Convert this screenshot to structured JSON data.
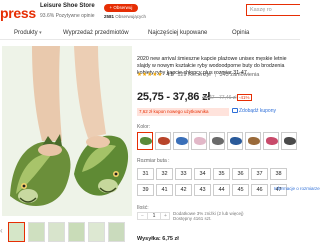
{
  "header": {
    "logo": "press",
    "store_name": "Leisure Shoe Store",
    "store_rating": "93.6% Pozytywne opinie",
    "follow_label": "+ Obserwuj",
    "followers_count": "2581",
    "followers_label": "Obserwujących",
    "search_placeholder": "Kaszę ro"
  },
  "nav": {
    "items": [
      {
        "label": "Produkty",
        "dropdown": true
      },
      {
        "label": "Wyprzedaż przedmiotów",
        "dropdown": false
      },
      {
        "label": "Najczęściej kupowane",
        "dropdown": false
      },
      {
        "label": "Opinia",
        "dropdown": false
      }
    ]
  },
  "product": {
    "title": "2020 new arrival śmieszne kapcie plażowe unisex męskie letnie slajdy w nowym kształcie ryby wodoodporne buty do brodzenia kobiety ryby kapcie chłopcy plus rozmiar 31-47",
    "rating_value": "4.8",
    "rating_stars": "★★★★★",
    "reviews": "129 Recenzje",
    "orders": "343 zamówienia",
    "price": "25,75 - 37,86 zł",
    "old_price": "40,87 - 77,46 zł",
    "discount": "-41%",
    "coupon_text": "7,62 zł kupon nowego użytkownika",
    "coupons_link": "Zdobądź kupony",
    "color_label": "Kolor:",
    "swatch_colors": [
      "#5a8a3a",
      "#b8442a",
      "#3a6fb8",
      "#e2b8c8",
      "#6a6a6a",
      "#2a5a9a",
      "#9a6a3a",
      "#c84a6a",
      "#4a4a4a"
    ],
    "size_label": "Rozmiar buta :",
    "sizes": [
      "31",
      "32",
      "33",
      "34",
      "35",
      "36",
      "37",
      "38",
      "39",
      "41",
      "42",
      "43",
      "44",
      "45",
      "46",
      "47"
    ],
    "size_info": "Informacje o rozmiarze",
    "qty_label": "Ilość:",
    "qty_value": "1",
    "qty_note_1": "Dodatkowe 3% zniżki (2 lub więcej)",
    "qty_note_2": "Dostępny 4161 szt.",
    "shipping": "Wysyłka: 6,75 zł"
  },
  "colors": {
    "accent": "#e62e04",
    "link": "#2e6fd8"
  }
}
